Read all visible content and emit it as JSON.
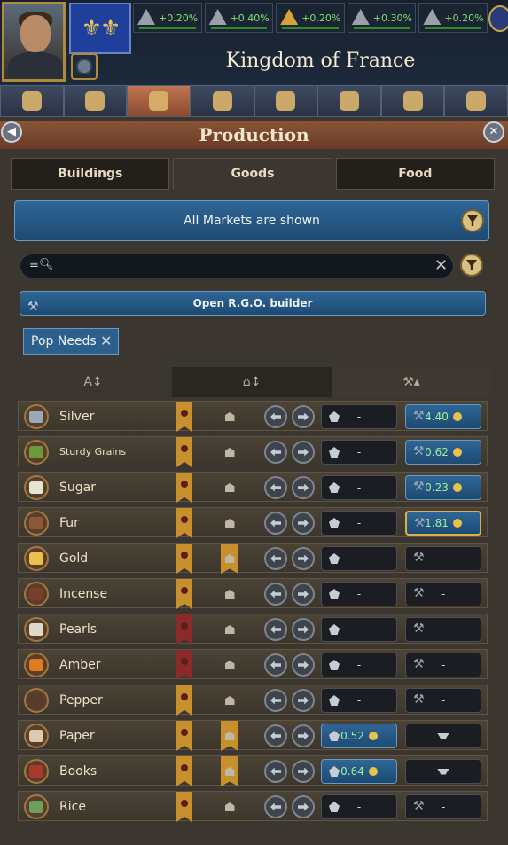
{
  "header": {
    "country": "Kingdom of France",
    "stats": [
      {
        "value": "+0.20%",
        "icon": "stability-icon",
        "tone": "gray"
      },
      {
        "value": "+0.40%",
        "icon": "prestige-icon",
        "tone": "gray"
      },
      {
        "value": "+0.20%",
        "icon": "legitimacy-icon",
        "tone": "orange"
      },
      {
        "value": "+0.30%",
        "icon": "military-icon",
        "tone": "gray"
      },
      {
        "value": "+0.20%",
        "icon": "crown-icon",
        "tone": "gray"
      }
    ],
    "category_tabs": [
      "government-icon",
      "economy-icon",
      "production-icon",
      "diplomacy-icon",
      "trade-icon",
      "military-icon",
      "map-icon",
      "research-icon"
    ],
    "active_tab_index": 2
  },
  "panel": {
    "title": "Production",
    "tabs": [
      "Buildings",
      "Goods",
      "Food"
    ],
    "active_tab": "Goods",
    "market_filter": "All Markets are shown",
    "search": {
      "value": "",
      "placeholder": ""
    },
    "rgo_button": "Open R.G.O. builder",
    "active_filter_chip": "Pop Needs"
  },
  "colors": {
    "accent_blue": "#2f6696",
    "gold": "#c8902c",
    "panel_bg": "#3b3630",
    "positive_green": "#9ef09a"
  },
  "goods": [
    {
      "name": "Silver",
      "icon_color": "#9aa8b8",
      "ribbon": "gold",
      "bldg_ribbon": false,
      "market": "-",
      "market_active": false,
      "rgo": "4.40",
      "rgo_active": true,
      "rgo_selected": false
    },
    {
      "name": "Sturdy Grains",
      "icon_color": "#6a9a3a",
      "ribbon": "gold",
      "bldg_ribbon": false,
      "market": "-",
      "market_active": false,
      "rgo": "0.62",
      "rgo_active": true,
      "rgo_selected": false,
      "small": true
    },
    {
      "name": "Sugar",
      "icon_color": "#e6e6d0",
      "ribbon": "gold",
      "bldg_ribbon": false,
      "market": "-",
      "market_active": false,
      "rgo": "0.23",
      "rgo_active": true,
      "rgo_selected": false
    },
    {
      "name": "Fur",
      "icon_color": "#8a5a36",
      "ribbon": "gold",
      "bldg_ribbon": false,
      "market": "-",
      "market_active": false,
      "rgo": "1.81",
      "rgo_active": true,
      "rgo_selected": true
    },
    {
      "name": "Gold",
      "icon_color": "#e8c24a",
      "ribbon": "gold",
      "bldg_ribbon": true,
      "market": "-",
      "market_active": false,
      "rgo": "-",
      "rgo_active": false,
      "rgo_selected": false
    },
    {
      "name": "Incense",
      "icon_color": "#7a3e2a",
      "ribbon": "gold",
      "bldg_ribbon": false,
      "market": "-",
      "market_active": false,
      "rgo": "-",
      "rgo_active": false,
      "rgo_selected": false
    },
    {
      "name": "Pearls",
      "icon_color": "#e0d8c8",
      "ribbon": "red",
      "bldg_ribbon": false,
      "market": "-",
      "market_active": false,
      "rgo": "-",
      "rgo_active": false,
      "rgo_selected": false
    },
    {
      "name": "Amber",
      "icon_color": "#e07a1a",
      "ribbon": "red",
      "bldg_ribbon": false,
      "market": "-",
      "market_active": false,
      "rgo": "-",
      "rgo_active": false,
      "rgo_selected": false
    },
    {
      "name": "Pepper",
      "icon_color": "#5a3a2a",
      "ribbon": "gold",
      "bldg_ribbon": false,
      "market": "-",
      "market_active": false,
      "rgo": "-",
      "rgo_active": false,
      "rgo_selected": false
    },
    {
      "name": "Paper",
      "icon_color": "#d8cbb0",
      "ribbon": "gold",
      "bldg_ribbon": true,
      "market": "0.52",
      "market_active": true,
      "rgo": "",
      "rgo_active": false,
      "rgo_selected": false,
      "anvil": true
    },
    {
      "name": "Books",
      "icon_color": "#a83a2a",
      "ribbon": "gold",
      "bldg_ribbon": true,
      "market": "0.64",
      "market_active": true,
      "rgo": "",
      "rgo_active": false,
      "rgo_selected": false,
      "anvil": true
    },
    {
      "name": "Rice",
      "icon_color": "#6aa05a",
      "ribbon": "gold",
      "bldg_ribbon": false,
      "market": "-",
      "market_active": false,
      "rgo": "-",
      "rgo_active": false,
      "rgo_selected": false
    }
  ]
}
